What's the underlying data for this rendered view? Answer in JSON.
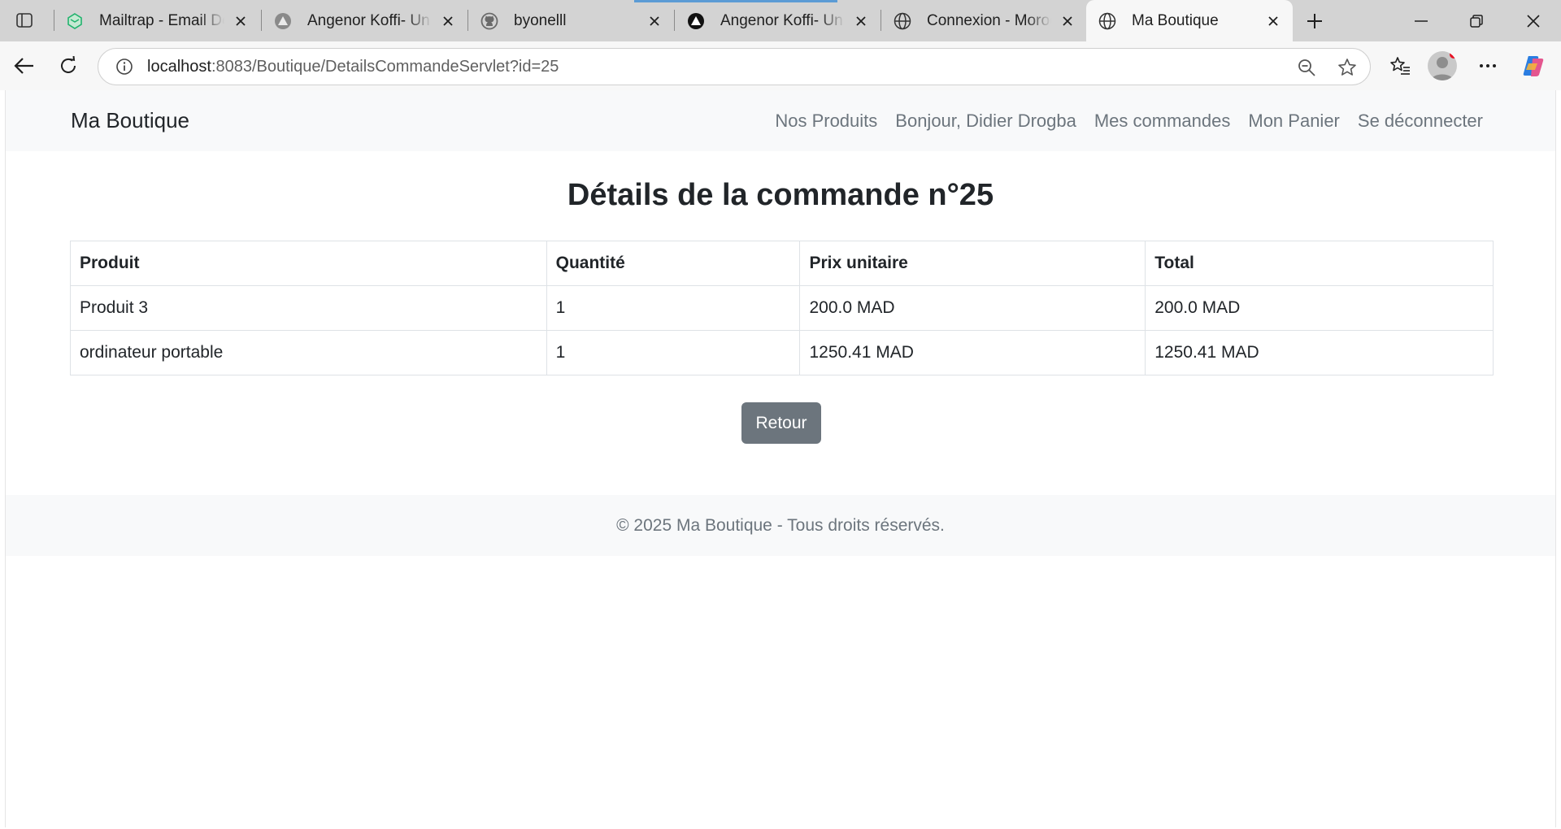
{
  "browser": {
    "tabs": [
      {
        "title": "Mailtrap - Email Delivery",
        "favicon": "mailtrap-icon"
      },
      {
        "title": "Angenor Koffi- Un portfolio",
        "favicon": "vercel-icon"
      },
      {
        "title": "byonelll",
        "favicon": "github-icon"
      },
      {
        "title": "Angenor Koffi- Un portfolio",
        "favicon": "vercel-icon"
      },
      {
        "title": "Connexion - Morocco",
        "favicon": "globe-icon"
      },
      {
        "title": "Ma Boutique",
        "favicon": "globe-icon",
        "active": true
      }
    ],
    "address": {
      "host": "localhost",
      "path": ":8083/Boutique/DetailsCommandeServlet?id=25"
    }
  },
  "site": {
    "brand": "Ma Boutique",
    "nav": {
      "products": "Nos Produits",
      "greeting": "Bonjour, Didier Drogba",
      "orders": "Mes commandes",
      "cart": "Mon Panier",
      "logout": "Se déconnecter"
    }
  },
  "main": {
    "title": "Détails de la commande n°25",
    "table": {
      "headers": [
        "Produit",
        "Quantité",
        "Prix unitaire",
        "Total"
      ],
      "rows": [
        [
          "Produit 3",
          "1",
          "200.0 MAD",
          "200.0 MAD"
        ],
        [
          "ordinateur portable",
          "1",
          "1250.41 MAD",
          "1250.41 MAD"
        ]
      ]
    },
    "back_button": "Retour"
  },
  "footer": {
    "text": "© 2025 Ma Boutique - Tous droits réservés."
  },
  "colors": {
    "navbar_bg": "#f8f9fa",
    "nav_link": "#6c757d",
    "button_secondary": "#6c757d",
    "text": "#212529"
  }
}
